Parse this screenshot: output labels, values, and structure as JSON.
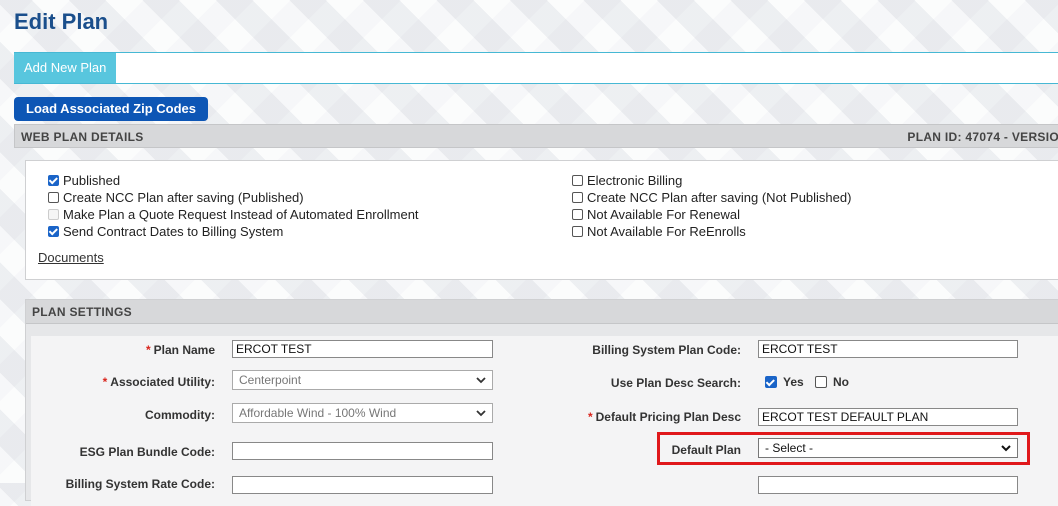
{
  "page": {
    "title": "Edit Plan"
  },
  "tabs": [
    {
      "label": "Add New Plan"
    }
  ],
  "actions": {
    "load_zip_codes": "Load Associated Zip Codes"
  },
  "web_plan_details": {
    "header": "WEB PLAN DETAILS",
    "plan_id_label": "PLAN ID: 47074 - VERSIO",
    "left_options": [
      {
        "label": "Published",
        "checked": true
      },
      {
        "label": "Create NCC Plan after saving (Published)",
        "checked": false
      },
      {
        "label": "Make Plan a Quote Request Instead of Automated Enrollment",
        "checked": false,
        "disabled": true
      },
      {
        "label": "Send Contract Dates to Billing System",
        "checked": true
      }
    ],
    "right_options": [
      {
        "label": "Electronic Billing",
        "checked": false
      },
      {
        "label": "Create NCC Plan after saving (Not Published)",
        "checked": false
      },
      {
        "label": "Not Available For Renewal",
        "checked": false
      },
      {
        "label": "Not Available For ReEnrolls",
        "checked": false
      }
    ],
    "documents_link": "Documents"
  },
  "plan_settings": {
    "header": "PLAN SETTINGS",
    "plan_name": {
      "label": "Plan Name",
      "value": "ERCOT TEST"
    },
    "associated_utility": {
      "label": "Associated Utility:",
      "value": "Centerpoint"
    },
    "commodity": {
      "label": "Commodity:",
      "value": "Affordable Wind - 100% Wind"
    },
    "esg_bundle_code": {
      "label": "ESG Plan Bundle Code:",
      "value": ""
    },
    "billing_rate_code": {
      "label": "Billing System Rate Code:",
      "value": ""
    },
    "billing_plan_code": {
      "label": "Billing System Plan Code:",
      "value": "ERCOT TEST"
    },
    "use_plan_desc_search": {
      "label": "Use Plan Desc Search:",
      "yes": "Yes",
      "no": "No",
      "yes_checked": true,
      "no_checked": false
    },
    "default_pricing_desc": {
      "label": "Default Pricing Plan Desc",
      "value": "ERCOT TEST DEFAULT PLAN"
    },
    "default_plan": {
      "label": "Default Plan",
      "value": "- Select -"
    },
    "required_mark": "*"
  },
  "colors": {
    "accent": "#0d56b5",
    "tab": "#58c6de",
    "title": "#1b4f8c",
    "required": "#d9241c",
    "highlight": "#e0181b"
  }
}
